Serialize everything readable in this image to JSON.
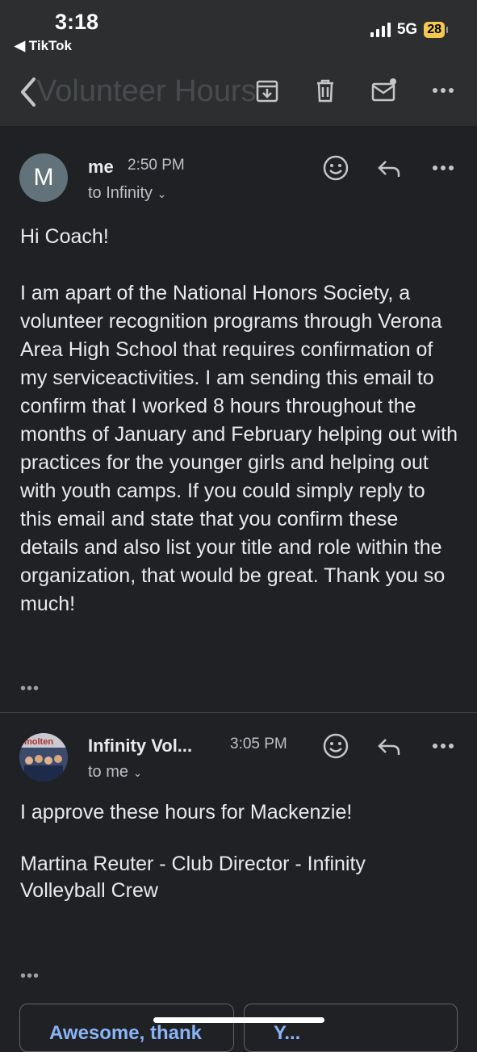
{
  "status_bar": {
    "time": "3:18",
    "back_app": "◀ TikTok",
    "network": "5G",
    "battery": "28"
  },
  "toolbar": {
    "subject_ghost": "Volunteer Hours"
  },
  "message1": {
    "avatar_letter": "M",
    "sender": "me",
    "time": "2:50 PM",
    "to": "to Infinity",
    "greeting": "Hi Coach!",
    "body": "I am apart of the National Honors Society, a volunteer recognition programs through Verona Area High School that requires confirmation of my serviceactivities. I am sending this email to confirm that I worked 8 hours throughout the months of January and February helping out with practices for the younger girls and helping out with youth camps. If you could simply reply to this email and state that you confirm these details and also list your title and role within the organization, that would be great. Thank you so much!"
  },
  "message2": {
    "avatar_text": "molten",
    "sender": "Infinity Vol...",
    "time": "3:05 PM",
    "to": "to me",
    "line1": "I approve these hours for Mackenzie!",
    "signature": "Martina Reuter - Club Director - Infinity Volleyball Crew"
  },
  "smart_replies": [
    "Awesome, thank",
    "Y..."
  ],
  "colors": {
    "background": "#202124",
    "toolbar": "#2d2e30",
    "accent": "#8ab4f8",
    "battery": "#f2c94c"
  }
}
